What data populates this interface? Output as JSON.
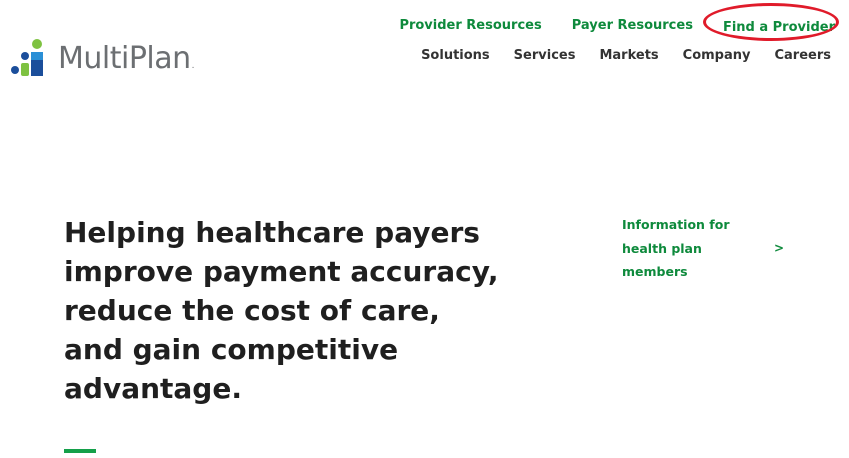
{
  "logo": {
    "text": "MultiPlan",
    "registered": "."
  },
  "utility_nav": {
    "provider_resources": "Provider Resources",
    "payer_resources": "Payer Resources",
    "find_a_provider": "Find a Provider"
  },
  "main_nav": {
    "solutions": "Solutions",
    "services": "Services",
    "markets": "Markets",
    "company": "Company",
    "careers": "Careers"
  },
  "hero": {
    "headline": "Helping healthcare payers improve payment accuracy, reduce the cost of care, and gain competitive advantage."
  },
  "info_link": {
    "text": "Information for health plan members",
    "arrow": ">"
  },
  "colors": {
    "brand_green": "#0e8a3c",
    "accent_green": "#14a04a",
    "logo_gray": "#6c6f72",
    "logo_blue": "#1b4e9b",
    "highlight_red": "#e01b2a"
  }
}
